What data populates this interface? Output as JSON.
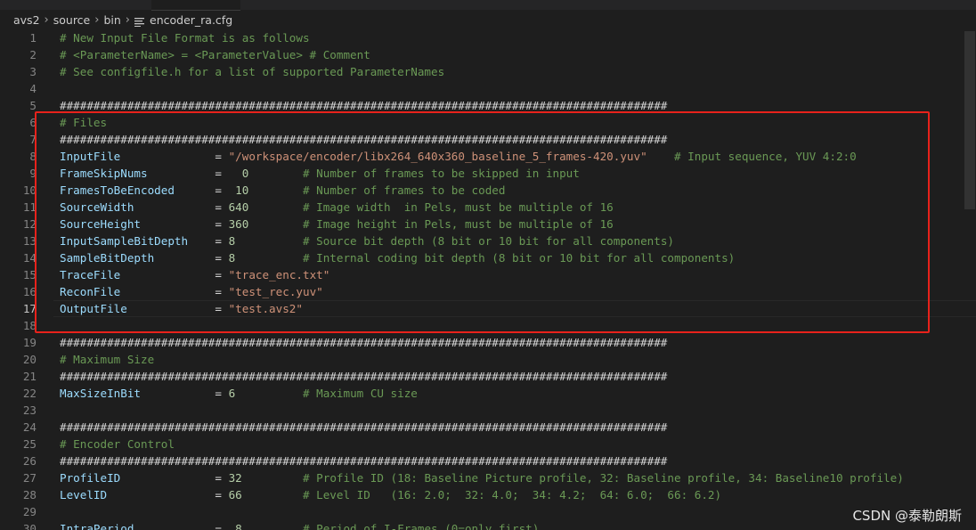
{
  "breadcrumb": {
    "items": [
      "avs2",
      "source",
      "bin"
    ],
    "file": "encoder_ra.cfg",
    "separator": "›"
  },
  "editor": {
    "current_line": 17,
    "lines": [
      {
        "n": "1",
        "code": "# New Input File Format is as follows",
        "comment": ""
      },
      {
        "n": "2",
        "code": "# <ParameterName> = <ParameterValue> # Comment",
        "comment": ""
      },
      {
        "n": "3",
        "code": "# See configfile.h for a list of supported ParameterNames",
        "comment": ""
      },
      {
        "n": "4",
        "code": "",
        "comment": ""
      },
      {
        "n": "5",
        "code": "##########################################################################################",
        "comment": ""
      },
      {
        "n": "6",
        "code": "# Files",
        "comment": ""
      },
      {
        "n": "7",
        "code": "##########################################################################################",
        "comment": ""
      },
      {
        "n": "8",
        "code": "InputFile              = \"/workspace/encoder/libx264_640x360_baseline_5_frames-420.yuv\"",
        "comment": "    # Input sequence, YUV 4:2:0"
      },
      {
        "n": "9",
        "code": "FrameSkipNums          =   0",
        "comment": "        # Number of frames to be skipped in input"
      },
      {
        "n": "10",
        "code": "FramesToBeEncoded      =  10",
        "comment": "        # Number of frames to be coded"
      },
      {
        "n": "11",
        "code": "SourceWidth            = 640",
        "comment": "        # Image width  in Pels, must be multiple of 16"
      },
      {
        "n": "12",
        "code": "SourceHeight           = 360",
        "comment": "        # Image height in Pels, must be multiple of 16"
      },
      {
        "n": "13",
        "code": "InputSampleBitDepth    = 8",
        "comment": "          # Source bit depth (8 bit or 10 bit for all components)"
      },
      {
        "n": "14",
        "code": "SampleBitDepth         = 8",
        "comment": "          # Internal coding bit depth (8 bit or 10 bit for all components)"
      },
      {
        "n": "15",
        "code": "TraceFile              = \"trace_enc.txt\"",
        "comment": ""
      },
      {
        "n": "16",
        "code": "ReconFile              = \"test_rec.yuv\"",
        "comment": ""
      },
      {
        "n": "17",
        "code": "OutputFile             = \"test.avs2\"",
        "comment": ""
      },
      {
        "n": "18",
        "code": "",
        "comment": ""
      },
      {
        "n": "19",
        "code": "##########################################################################################",
        "comment": ""
      },
      {
        "n": "20",
        "code": "# Maximum Size",
        "comment": ""
      },
      {
        "n": "21",
        "code": "##########################################################################################",
        "comment": ""
      },
      {
        "n": "22",
        "code": "MaxSizeInBit           = 6",
        "comment": "          # Maximum CU size"
      },
      {
        "n": "23",
        "code": "",
        "comment": ""
      },
      {
        "n": "24",
        "code": "##########################################################################################",
        "comment": ""
      },
      {
        "n": "25",
        "code": "# Encoder Control",
        "comment": ""
      },
      {
        "n": "26",
        "code": "##########################################################################################",
        "comment": ""
      },
      {
        "n": "27",
        "code": "ProfileID              = 32",
        "comment": "         # Profile ID (18: Baseline Picture profile, 32: Baseline profile, 34: Baseline10 profile)"
      },
      {
        "n": "28",
        "code": "LevelID                = 66",
        "comment": "         # Level ID   (16: 2.0;  32: 4.0;  34: 4.2;  64: 6.0;  66: 6.2)"
      },
      {
        "n": "29",
        "code": "",
        "comment": ""
      },
      {
        "n": "30",
        "code": "IntraPeriod            =  8",
        "comment": "         # Period of I-Frames (0=only first)"
      }
    ]
  },
  "watermark": "CSDN @泰勒朗斯",
  "colors": {
    "background": "#1e1e1e",
    "comment": "#6a9955",
    "key": "#9cdcfe",
    "number": "#b5cea8",
    "string": "#ce9178",
    "highlight_box": "#e8221b"
  }
}
